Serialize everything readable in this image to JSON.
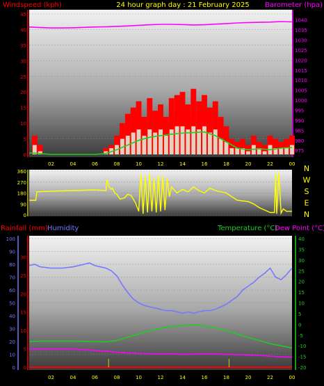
{
  "title": "24 hour graph day : 21 February 2025",
  "colors": {
    "wind": "#ff0000",
    "gust": "#ff0000",
    "windavg": "#22cc22",
    "baro": "#ff00ff",
    "dir": "#ffff00",
    "rain": "#ff0000",
    "humidity": "#7777ff",
    "temp": "#22cc22",
    "dew": "#ff00ff",
    "compass": "#ffff00",
    "axisLabel": "#ffff00"
  },
  "chart_data": [
    {
      "type": "line",
      "name": "wind-barometer",
      "left_axis_label": "Windspeed (kph)",
      "right_axis_label": "Barometer (hpa)",
      "x_ticks": [
        "02",
        "04",
        "06",
        "08",
        "10",
        "12",
        "14",
        "16",
        "18",
        "20",
        "22",
        "00"
      ],
      "left_ticks": [
        0,
        5,
        10,
        15,
        20,
        25,
        30,
        35,
        40,
        45
      ],
      "right_ticks": [
        975,
        980,
        985,
        990,
        995,
        1000,
        1005,
        1010,
        1015,
        1020,
        1025,
        1030,
        1035,
        1040
      ],
      "ylim_left": [
        0,
        45
      ],
      "ylim_right": [
        973,
        1043
      ],
      "series": [
        {
          "key": "barometer",
          "axis": "right",
          "x": [
            0,
            1,
            2,
            3,
            4,
            5,
            6,
            7,
            8,
            9,
            10,
            11,
            12,
            13,
            14,
            15,
            16,
            17,
            18,
            19,
            20,
            21,
            22,
            23,
            24
          ],
          "values": [
            1036.5,
            1036.2,
            1036.0,
            1036.0,
            1036.1,
            1036.3,
            1036.5,
            1036.6,
            1036.8,
            1037.0,
            1037.3,
            1037.6,
            1037.8,
            1037.8,
            1037.7,
            1037.5,
            1037.6,
            1037.9,
            1038.2,
            1038.5,
            1038.7,
            1038.8,
            1038.9,
            1039.2,
            1039.0
          ]
        },
        {
          "key": "gust",
          "axis": "left",
          "x": [
            0,
            0.5,
            1,
            1.5,
            2,
            2.5,
            3,
            3.5,
            4,
            4.5,
            5,
            5.5,
            6,
            6.5,
            7,
            7.5,
            8,
            8.5,
            9,
            9.5,
            10,
            10.5,
            11,
            11.5,
            12,
            12.5,
            13,
            13.5,
            14,
            14.5,
            15,
            15.5,
            16,
            16.5,
            17,
            17.5,
            18,
            18.5,
            19,
            19.5,
            20,
            20.5,
            21,
            21.5,
            22,
            22.5,
            23,
            23.5,
            24
          ],
          "values": [
            0,
            6,
            3,
            0,
            0,
            0,
            0,
            0,
            0,
            0,
            0,
            0,
            0,
            0,
            2,
            3,
            6,
            10,
            13,
            15,
            17,
            12,
            18,
            14,
            16,
            12,
            18,
            19,
            20,
            16,
            21,
            17,
            19,
            15,
            17,
            12,
            9,
            5,
            4,
            5,
            3,
            6,
            4,
            3,
            6,
            5,
            4,
            5,
            6
          ]
        },
        {
          "key": "windspeed",
          "axis": "left",
          "x": [
            0,
            0.5,
            1,
            1.5,
            2,
            2.5,
            3,
            3.5,
            4,
            4.5,
            5,
            5.5,
            6,
            6.5,
            7,
            7.5,
            8,
            8.5,
            9,
            9.5,
            10,
            10.5,
            11,
            11.5,
            12,
            12.5,
            13,
            13.5,
            14,
            14.5,
            15,
            15.5,
            16,
            16.5,
            17,
            17.5,
            18,
            18.5,
            19,
            19.5,
            20,
            20.5,
            21,
            21.5,
            22,
            22.5,
            23,
            23.5,
            24
          ],
          "values": [
            0,
            3,
            1,
            0,
            0,
            0,
            0,
            0,
            0,
            0,
            0,
            0,
            0,
            0,
            1,
            2,
            3,
            5,
            6,
            7,
            8,
            6,
            8,
            7,
            8,
            6,
            8,
            9,
            9,
            8,
            9,
            8,
            9,
            7,
            8,
            5,
            4,
            2,
            2,
            2,
            1,
            3,
            2,
            1,
            3,
            2,
            2,
            2,
            3
          ]
        },
        {
          "key": "windavg",
          "axis": "left",
          "x": [
            0,
            1,
            2,
            3,
            4,
            5,
            6,
            7,
            8,
            9,
            10,
            11,
            12,
            13,
            14,
            15,
            16,
            17,
            18,
            19,
            20,
            21,
            22,
            23,
            24
          ],
          "values": [
            0.5,
            0.3,
            0,
            0,
            0,
            0,
            0,
            0.3,
            1.5,
            3,
            4.5,
            5.5,
            6,
            6.5,
            6.8,
            7,
            7.2,
            6,
            4,
            2,
            1.5,
            1.8,
            1.5,
            2,
            2.2
          ]
        }
      ]
    },
    {
      "type": "line",
      "name": "wind-direction",
      "compass": [
        "N",
        "W",
        "S",
        "E",
        "N"
      ],
      "left_ticks": [
        0,
        90,
        180,
        270,
        360
      ],
      "ylim": [
        0,
        360
      ],
      "series": [
        {
          "key": "direction",
          "x": [
            0,
            0.6,
            0.7,
            2,
            4,
            6,
            7.0,
            7.1,
            7.3,
            7.5,
            7.6,
            7.8,
            8,
            8.3,
            8.7,
            9,
            9.3,
            9.7,
            10,
            10.2,
            10.4,
            10.6,
            10.8,
            11,
            11.2,
            11.4,
            11.6,
            11.8,
            12,
            12.2,
            12.4,
            12.6,
            12.8,
            13,
            13.5,
            14,
            14.5,
            15,
            15.5,
            16,
            16.5,
            17,
            17.5,
            18,
            18.5,
            19,
            20,
            20.5,
            21,
            22,
            22.4,
            22.5,
            22.6,
            22.8,
            23,
            23.2,
            23.5,
            24
          ],
          "values": [
            120,
            120,
            190,
            195,
            200,
            205,
            200,
            290,
            230,
            210,
            220,
            180,
            170,
            130,
            140,
            170,
            160,
            100,
            30,
            340,
            10,
            320,
            20,
            340,
            30,
            300,
            20,
            330,
            30,
            320,
            40,
            300,
            150,
            230,
            180,
            210,
            190,
            230,
            200,
            180,
            220,
            200,
            190,
            180,
            150,
            120,
            110,
            90,
            60,
            20,
            20,
            340,
            10,
            350,
            15,
            50,
            30,
            30
          ]
        }
      ]
    },
    {
      "type": "line",
      "name": "temp-humidity-rain",
      "rain_axis_label": "Rainfall (mm)",
      "humidity_axis_label": "Humidity",
      "temp_axis_label": "Temperature (°C)",
      "dew_axis_label": "Dew Point (°C)",
      "x_ticks": [
        "02",
        "04",
        "06",
        "08",
        "10",
        "12",
        "14",
        "16",
        "18",
        "20",
        "22",
        "00"
      ],
      "humidity_ticks": [
        0,
        10,
        20,
        30,
        40,
        50,
        60,
        70,
        80,
        90,
        100
      ],
      "rain_ticks": [
        0,
        5,
        10,
        15,
        20,
        25,
        30
      ],
      "temp_ticks": [
        -20,
        -15,
        -10,
        -5,
        0,
        5,
        10,
        15,
        20,
        25,
        30,
        35,
        40
      ],
      "ylim_humidity": [
        0,
        100
      ],
      "ylim_rain": [
        0,
        35
      ],
      "ylim_temp": [
        -20,
        40
      ],
      "series": [
        {
          "key": "humidity",
          "x": [
            0,
            0.5,
            1,
            2,
            3,
            4,
            5,
            5.5,
            6,
            6.5,
            7,
            7.5,
            8,
            8.5,
            9,
            9.5,
            10,
            10.5,
            11,
            11.5,
            12,
            12.5,
            13,
            13.5,
            14,
            14.5,
            15,
            15.5,
            16,
            16.5,
            17,
            17.5,
            18,
            18.5,
            19,
            19.5,
            20,
            20.5,
            21,
            21.5,
            22,
            22.5,
            23,
            23.5,
            24
          ],
          "values": [
            79,
            80,
            78,
            77,
            77,
            78,
            80,
            81,
            79,
            78,
            77,
            75,
            71,
            64,
            58,
            53,
            50,
            48,
            47,
            46,
            45,
            44,
            44,
            43,
            42,
            43,
            42,
            43,
            44,
            44,
            45,
            47,
            49,
            52,
            55,
            60,
            63,
            66,
            70,
            73,
            77,
            70,
            68,
            72,
            77
          ]
        },
        {
          "key": "temperature",
          "x": [
            0,
            1,
            2,
            3,
            4,
            5,
            6,
            7,
            8,
            9,
            10,
            11,
            12,
            13,
            14,
            15,
            16,
            17,
            18,
            19,
            20,
            21,
            22,
            23,
            24
          ],
          "values": [
            -8,
            -7.8,
            -7.8,
            -7.8,
            -7.8,
            -7.9,
            -8,
            -8.2,
            -7.5,
            -6,
            -4.5,
            -3,
            -1.8,
            -1,
            -0.5,
            -0.2,
            -0.8,
            -1.8,
            -3,
            -4.5,
            -6.2,
            -7.5,
            -9,
            -10,
            -11
          ]
        },
        {
          "key": "dewpoint",
          "x": [
            0,
            1,
            2,
            3,
            4,
            5,
            6,
            7,
            8,
            9,
            10,
            11,
            12,
            13,
            14,
            15,
            16,
            17,
            18,
            19,
            20,
            21,
            22,
            23,
            24
          ],
          "values": [
            -11.5,
            -11.5,
            -11.5,
            -11.5,
            -11.5,
            -11.8,
            -12.2,
            -12.5,
            -13,
            -13.4,
            -13.5,
            -13.7,
            -13.8,
            -13.7,
            -14,
            -13.9,
            -13.7,
            -13.8,
            -14,
            -14.1,
            -14.3,
            -14.5,
            -14.8,
            -15.2,
            -15.3
          ]
        },
        {
          "key": "rainfall",
          "x": [
            0,
            24
          ],
          "values": [
            0,
            0
          ]
        }
      ]
    }
  ]
}
